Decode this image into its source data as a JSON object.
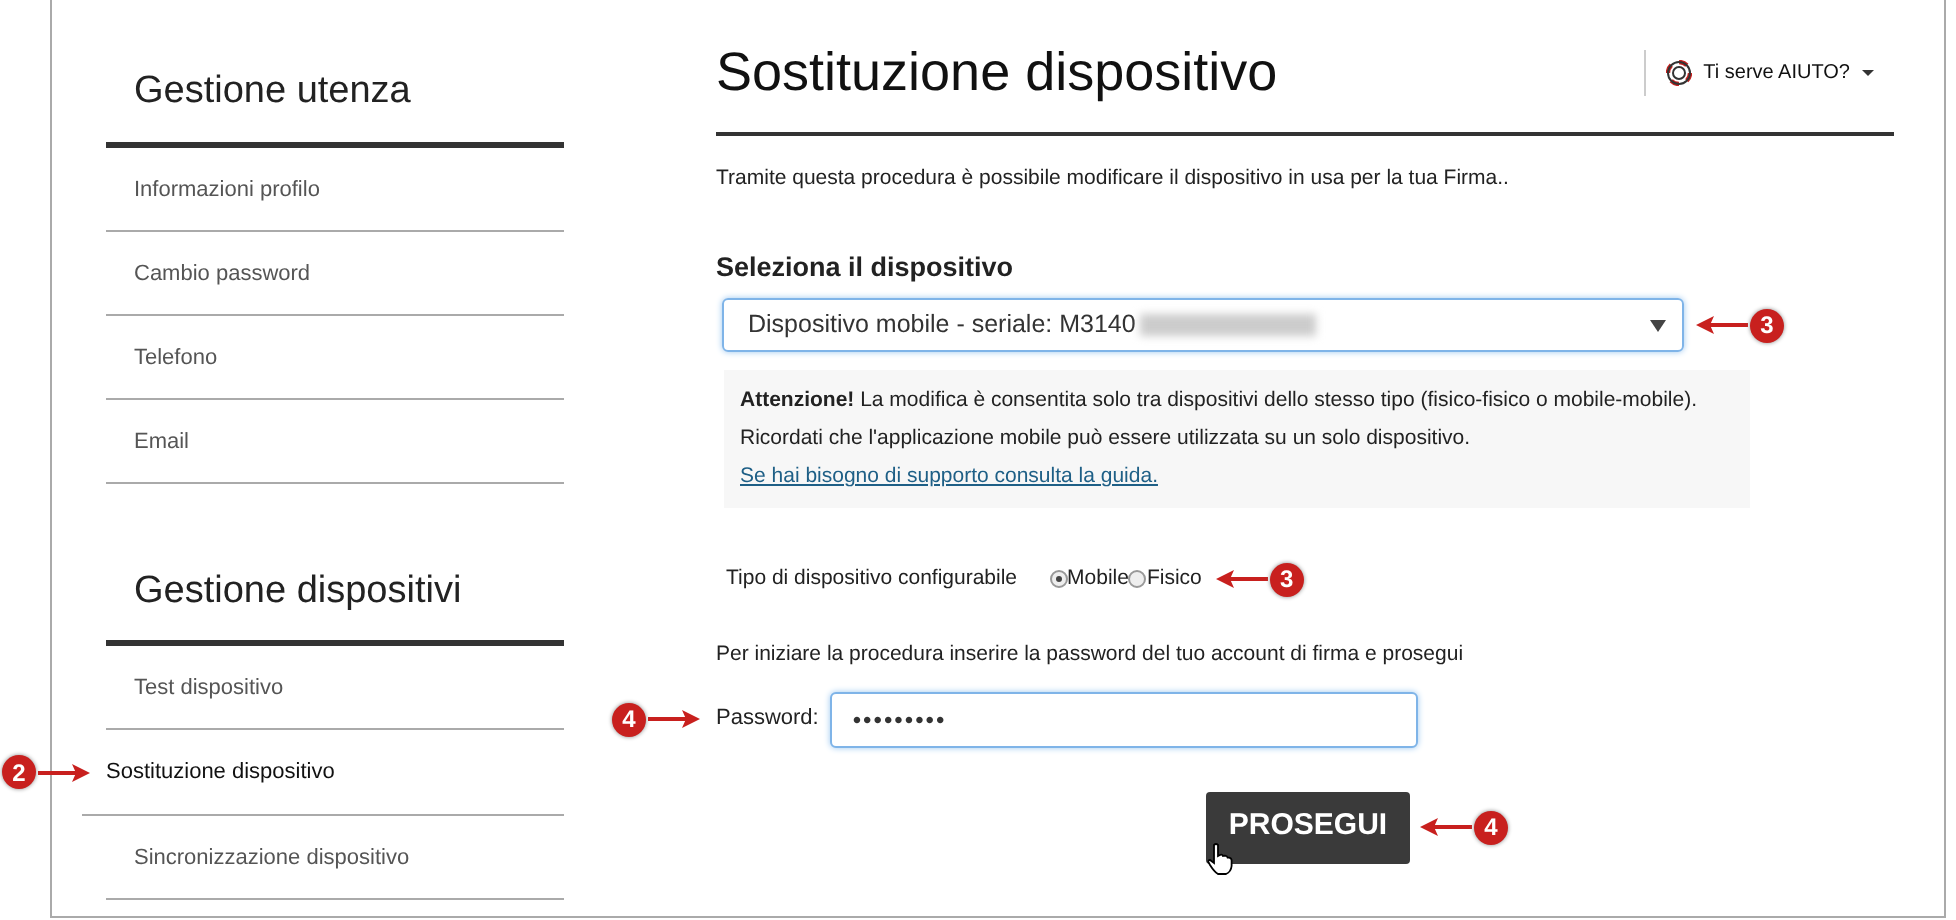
{
  "sidebar": {
    "sections": [
      {
        "title": "Gestione utenza",
        "items": [
          {
            "label": "Informazioni profilo",
            "selected": false
          },
          {
            "label": "Cambio password",
            "selected": false
          },
          {
            "label": "Telefono",
            "selected": false
          },
          {
            "label": "Email",
            "selected": false
          }
        ]
      },
      {
        "title": "Gestione dispositivi",
        "items": [
          {
            "label": "Test dispositivo",
            "selected": false
          },
          {
            "label": "Sostituzione dispositivo",
            "selected": true,
            "callout": {
              "number": "2",
              "kind": "left"
            }
          },
          {
            "label": "Sincronizzazione dispositivo",
            "selected": false
          }
        ]
      }
    ]
  },
  "page": {
    "title": "Sostituzione dispositivo",
    "help": "Ti serve AIUTO?",
    "intro": "Tramite questa procedura è possibile modificare il dispositivo in usa per la tua Firma..",
    "device_select": {
      "label": "Seleziona il dispositivo",
      "value": "Dispositivo mobile - seriale: M3140",
      "redacted": true,
      "callout": {
        "number": "3",
        "kind": "right"
      }
    },
    "notice": {
      "lines": [
        "**Attenzione!** La modifica è consentita solo tra dispositivi dello stesso tipo (fisico-fisico o mobile-mobile).",
        "Ricordati che l'applicazione mobile può essere utilizzata su un solo dispositivo."
      ],
      "link": "Se hai bisogno di supporto consulta la guida."
    },
    "device_type": {
      "label": "Tipo di dispositivo configurabile",
      "options": [
        {
          "label": "Mobile",
          "selected": true
        },
        {
          "label": "Fisico",
          "selected": false
        }
      ],
      "callout": {
        "number": "3",
        "kind": "right"
      }
    },
    "instruction": "Per iniziare la procedura inserire la password del tuo account di firma e prosegui",
    "password": {
      "label": "Password:",
      "value": "•••••••••",
      "callout": {
        "number": "4",
        "kind": "left"
      }
    },
    "submit": {
      "label": "PROSEGUI",
      "callout": {
        "number": "4",
        "kind": "right"
      }
    }
  }
}
